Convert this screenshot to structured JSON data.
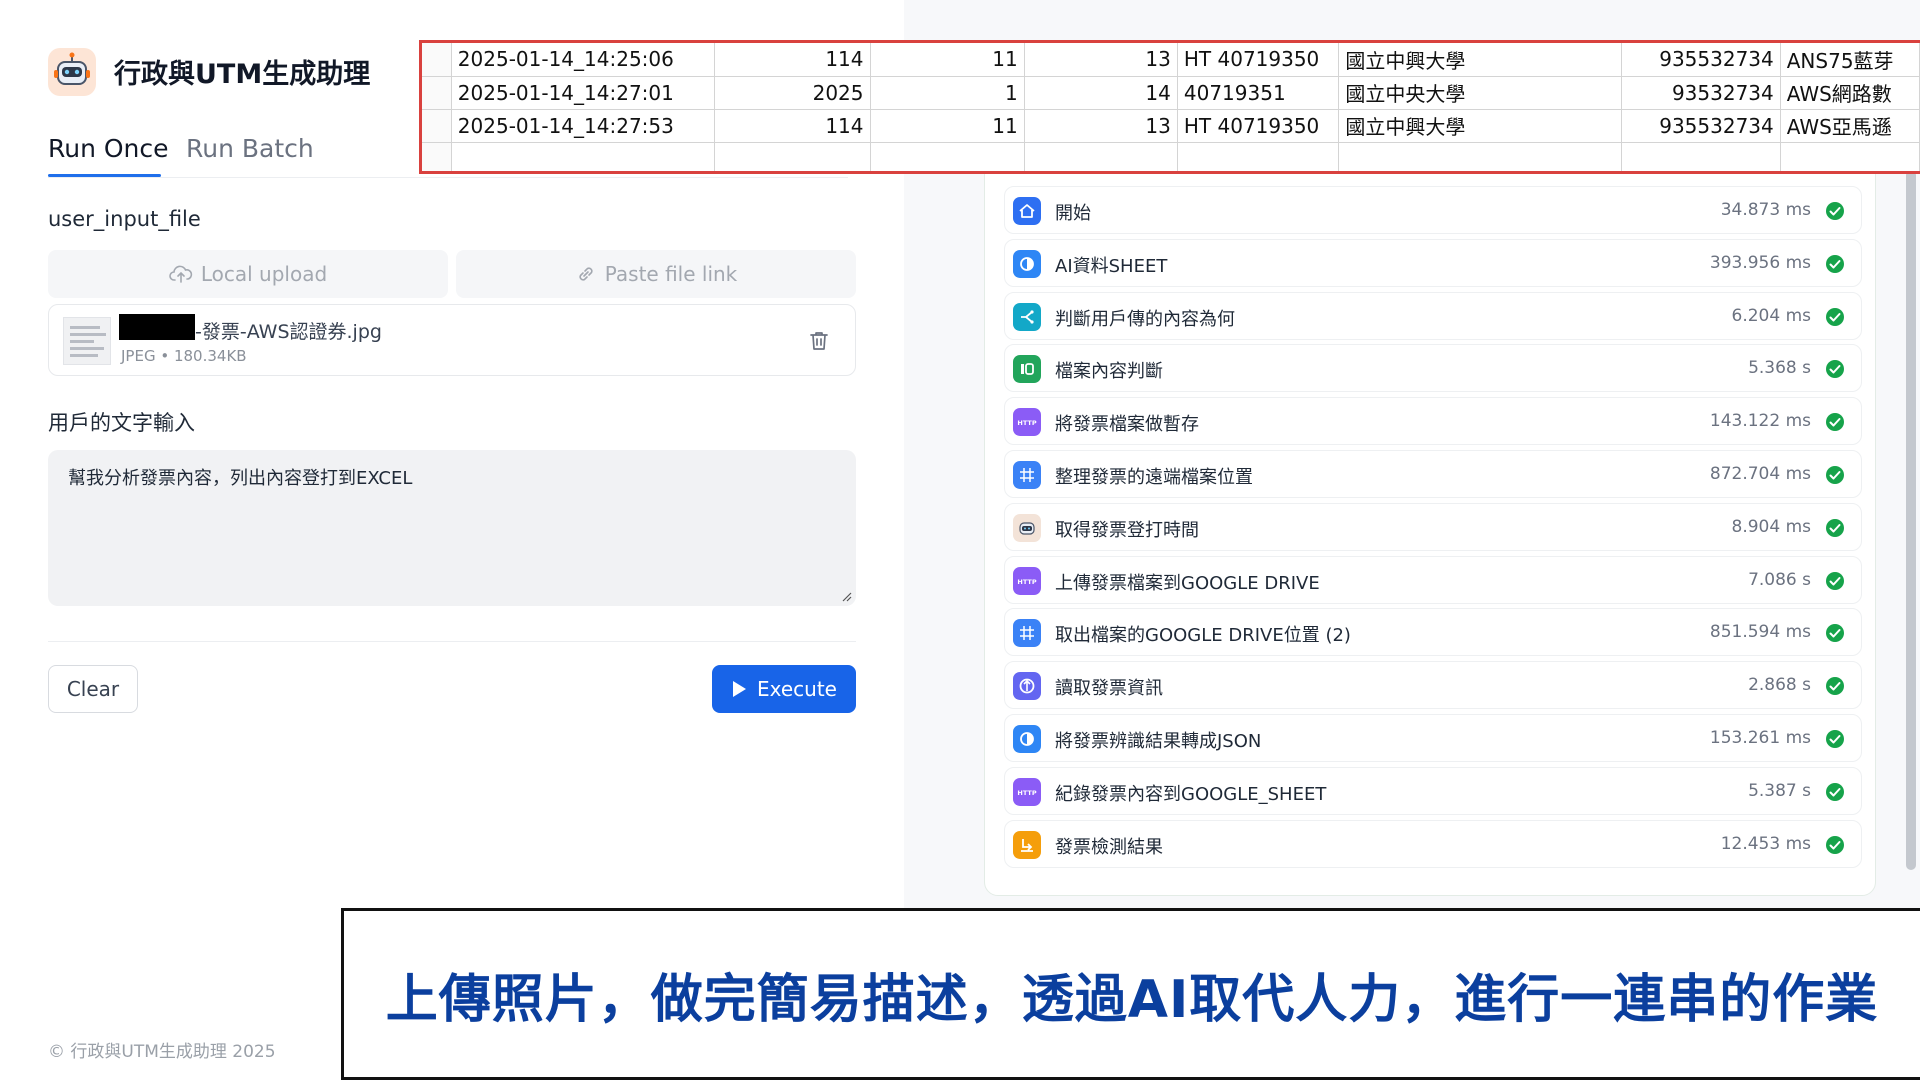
{
  "app": {
    "title": "行政與UTM生成助理",
    "tabs": [
      {
        "label": "Run Once",
        "active": true
      },
      {
        "label": "Run Batch",
        "active": false
      }
    ],
    "footer": "© 行政與UTM生成助理 2025"
  },
  "form": {
    "file_field_label": "user_input_file",
    "local_upload_label": "Local upload",
    "paste_link_label": "Paste file link",
    "file": {
      "name_suffix": "-發票-AWS認證券.jpg",
      "type": "JPEG",
      "size": "180.34KB"
    },
    "text_field_label": "用戶的文字輸入",
    "text_value": "幫我分析發票內容，列出內容登打到EXCEL",
    "clear_label": "Clear",
    "execute_label": "Execute"
  },
  "trace": [
    {
      "name": "開始",
      "time": "34.873 ms",
      "icon": "home-icon",
      "color": "#2e6ff2"
    },
    {
      "name": "AI資料SHEET",
      "time": "393.956 ms",
      "icon": "llm-icon",
      "color": "#2e86f5"
    },
    {
      "name": "判斷用戶傳的內容為何",
      "time": "6.204 ms",
      "icon": "branch-icon",
      "color": "#13a8c8"
    },
    {
      "name": "檔案內容判斷",
      "time": "5.368 s",
      "icon": "classifier-icon",
      "color": "#22a55b"
    },
    {
      "name": "將發票檔案做暫存",
      "time": "143.122 ms",
      "icon": "http-icon",
      "color": "#8b5cf6"
    },
    {
      "name": "整理發票的遠端檔案位置",
      "time": "872.704 ms",
      "icon": "code-icon",
      "color": "#3b82f6"
    },
    {
      "name": "取得發票登打時間",
      "time": "8.904 ms",
      "icon": "robot-icon",
      "color": "#f3e3d8"
    },
    {
      "name": "上傳發票檔案到GOOGLE DRIVE",
      "time": "7.086 s",
      "icon": "http-icon",
      "color": "#8b5cf6"
    },
    {
      "name": "取出檔案的GOOGLE DRIVE位置 (2)",
      "time": "851.594 ms",
      "icon": "code-icon",
      "color": "#3b82f6"
    },
    {
      "name": "讀取發票資訊",
      "time": "2.868 s",
      "icon": "tool-icon",
      "color": "#6366f1"
    },
    {
      "name": "將發票辨識結果轉成JSON",
      "time": "153.261 ms",
      "icon": "llm-icon",
      "color": "#2e86f5"
    },
    {
      "name": "紀錄發票內容到GOOGLE_SHEET",
      "time": "5.387 s",
      "icon": "http-icon",
      "color": "#8b5cf6"
    },
    {
      "name": "發票檢測結果",
      "time": "12.453 ms",
      "icon": "end-icon",
      "color": "#f59e0b"
    }
  ],
  "sheet": {
    "rows": [
      [
        "2025-01-14_14:25:06",
        "114",
        "11",
        "13",
        "HT 40719350",
        "國立中興大學",
        "935532734",
        "ANS75藍芽"
      ],
      [
        "2025-01-14_14:27:01",
        "2025",
        "1",
        "14",
        "40719351",
        "國立中央大學",
        "93532734",
        "AWS網路數"
      ],
      [
        "2025-01-14_14:27:53",
        "114",
        "11",
        "13",
        "HT 40719350",
        "國立中興大學",
        "935532734",
        "AWS亞馬遜"
      ],
      [
        "",
        "",
        "",
        "",
        "",
        "",
        "",
        ""
      ]
    ]
  },
  "caption": "上傳照片，做完簡易描述，透過AI取代人力，進行一連串的作業",
  "colors": {
    "accent": "#1864e8",
    "success": "#16a34a",
    "highlight_border": "#d9413e",
    "caption_text": "#0b3f9e"
  }
}
